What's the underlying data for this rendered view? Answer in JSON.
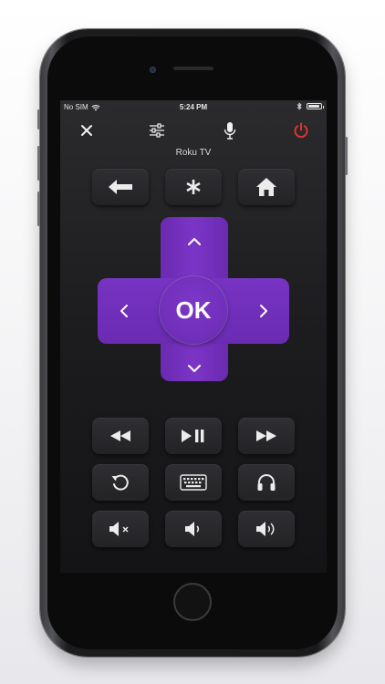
{
  "status_bar": {
    "carrier": "No SIM",
    "time": "5:24 PM",
    "battery_level": 0.9,
    "icons": [
      "wifi-icon",
      "bluetooth-icon",
      "battery-icon"
    ]
  },
  "toolbar": {
    "icons": [
      "close-icon",
      "sliders-icon",
      "microphone-icon",
      "power-icon"
    ],
    "power_color": "#e0342c"
  },
  "device": {
    "name": "Roku TV"
  },
  "dpad": {
    "ok_label": "OK",
    "color": "#6f2fb8",
    "icons": [
      "chevron-up-icon",
      "chevron-left-icon",
      "chevron-right-icon",
      "chevron-down-icon"
    ]
  },
  "top_row_buttons": [
    "back-icon",
    "asterisk-icon",
    "home-icon"
  ],
  "media_rows": [
    [
      "rewind-icon",
      "play-pause-icon",
      "fast-forward-icon"
    ],
    [
      "replay-icon",
      "keyboard-icon",
      "headphones-icon"
    ],
    [
      "mute-icon",
      "volume-down-icon",
      "volume-up-icon"
    ]
  ]
}
